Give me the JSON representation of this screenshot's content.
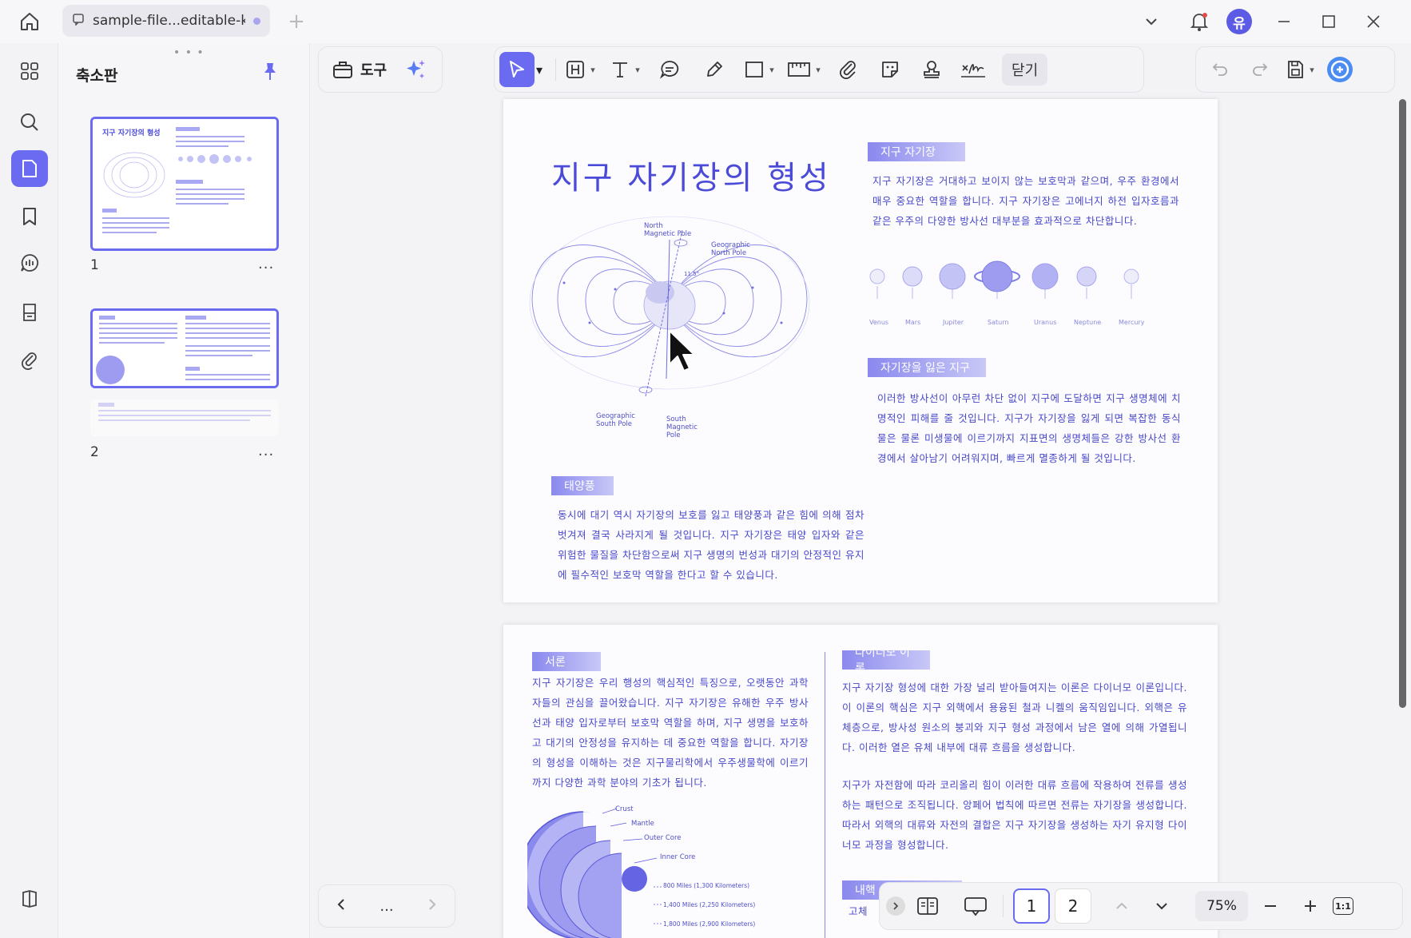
{
  "titlebar": {
    "tab_title": "sample-file...editable-kr",
    "avatar_initial": "유"
  },
  "thumbnails": {
    "panel_title": "축소판",
    "pages": [
      {
        "label": "1",
        "more": "..."
      },
      {
        "label": "2",
        "more": "..."
      }
    ]
  },
  "toolbar": {
    "tools_label": "도구",
    "close_label": "닫기"
  },
  "page1": {
    "title": "지구 자기장의 형성",
    "sections": [
      {
        "badge": "지구 자기장",
        "text": "지구 자기장은 거대하고 보이지 않는 보호막과 같으며, 우주 환경에서 매우 중요한 역할을 합니다. 지구 자기장은 고에너지 하전 입자호름과 같은 우주의 다양한 방사선 대부분을 효과적으로 차단합니다."
      },
      {
        "badge": "자기장을 잃은 지구",
        "text": "이러한 방사선이 아무런 차단 없이 지구에 도달하면 지구 생명체에 치명적인 피해를 줄 것입니다. 지구가 자기장을 잃게 되면 복잡한 동식물은 물론 미생물에 이르기까지 지표면의 생명체들은 강한 방사선 환경에서 살아남기 어려워지며, 빠르게 멸종하게 될 것입니다."
      },
      {
        "badge": "태양풍",
        "text": "동시에 대기 역시 자기장의 보호를 잃고 태양풍과 같은 힘에 의해 점차 벗겨져 결국 사라지게 될 것입니다. 지구 자기장은 태양 입자와 같은 위험한 물질을 차단함으로써 지구 생명의 번성과 대기의 안정적인 유지에 필수적인 보호막 역할을 한다고 할 수 있습니다."
      }
    ],
    "planets": [
      "Venus",
      "Mars",
      "Jupiter",
      "Saturn",
      "Uranus",
      "Neptune",
      "Mercury"
    ],
    "diagram_labels": {
      "north_magnetic": "North Magnetic Pole",
      "geo_north": "Geographic North Pole",
      "geo_south": "Geographic South Pole",
      "south_magnetic": "South Magnetic Pole",
      "angle": "11.5°"
    }
  },
  "page2": {
    "sections": [
      {
        "badge": "서론",
        "text": "지구 자기장은 우리 행성의 핵심적인 특징으로, 오랫동안 과학자들의 관심을 끌어왔습니다. 지구 자기장은 유해한 우주 방사선과 태양 입자로부터 보호막 역할을 하며, 지구 생명을 보호하고 대기의 안정성을 유지하는 데 중요한 역할을 합니다. 자기장의 형성을 이해하는 것은 지구물리학에서 우주생물학에 이르기까지 다양한 과학 분야의 기초가 됩니다."
      },
      {
        "badge": "다이너모 이론",
        "text": "지구 자기장 형성에 대한 가장 널리 받아들여지는 이론은 다이너모 이론입니다. 이 이론의 핵심은 지구 외핵에서 용융된 철과 니켈의 움직임입니다. 외핵은 유체층으로, 방사성 원소의 붕괴와 지구 형성 과정에서 남은 열에 의해 가열됩니다. 이러한 열은 유체 내부에 대류 흐름을 생성합니다."
      },
      {
        "badge": "",
        "text": "지구가 자전함에 따라 코리올리 힘이 이러한 대류 흐름에 작용하여 전류를 생성하는 패턴으로 조직됩니다. 앙페어 법칙에 따르면 전류는 자기장을 생성합니다. 따라서 외핵의 대류와 자전의 결합은 지구 자기장을 생성하는 자기 유지형 다이너모 과정을 형성합니다."
      },
      {
        "badge": "내핵",
        "text": "고체"
      }
    ],
    "core_labels": [
      "Crust",
      "Mantle",
      "Outer Core",
      "Inner Core",
      "800 Miles (1,300 Kilometers)",
      "1,400 Miles (2,250 Kilometers)",
      "1,800 Miles (2,900 Kilometers)"
    ]
  },
  "bottombar": {
    "pages": [
      "1",
      "2"
    ],
    "current_page": "1",
    "zoom": "75%",
    "more": "...",
    "fit_label": "1:1"
  },
  "colors": {
    "accent": "#6b6bf2",
    "doc_blue": "#4848c8"
  }
}
